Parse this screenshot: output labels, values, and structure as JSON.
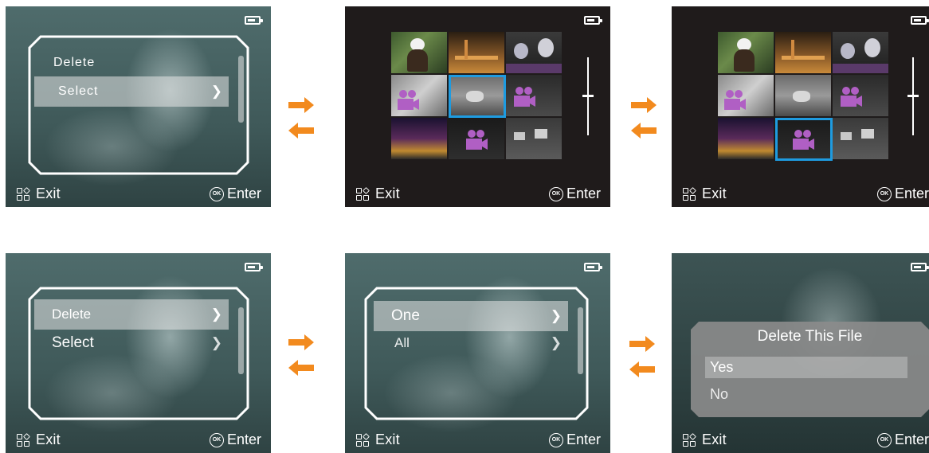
{
  "footer": {
    "exit_label": "Exit",
    "enter_label": "Enter",
    "ok_label": "OK"
  },
  "screen1": {
    "menu": [
      {
        "label": "Delete",
        "highlighted": false
      },
      {
        "label": "Select",
        "highlighted": true
      }
    ]
  },
  "screen4": {
    "menu": [
      {
        "label": "Delete",
        "highlighted": true
      },
      {
        "label": "Select",
        "highlighted": false
      }
    ]
  },
  "screen5": {
    "menu": [
      {
        "label": "One",
        "highlighted": true
      },
      {
        "label": "All",
        "highlighted": false
      }
    ]
  },
  "screen6": {
    "dialog_title": "Delete This File",
    "options": [
      {
        "label": "Yes",
        "highlighted": true
      },
      {
        "label": "No",
        "highlighted": false
      }
    ]
  },
  "thumbnails": {
    "screen2_selected_index": 4,
    "screen3_selected_index": 7,
    "items": [
      {
        "name": "eagle",
        "video": false
      },
      {
        "name": "wooden-deck",
        "video": false
      },
      {
        "name": "raccoons",
        "video": false
      },
      {
        "name": "tiger",
        "video": true
      },
      {
        "name": "deer-night",
        "video": false
      },
      {
        "name": "animal-night",
        "video": true
      },
      {
        "name": "city-night",
        "video": false
      },
      {
        "name": "dark-scene",
        "video": true
      },
      {
        "name": "deer-herd",
        "video": false
      }
    ]
  },
  "colors": {
    "accent_arrow": "#f28a1e",
    "selection": "#1e9be0",
    "video_icon": "#b05fc4"
  }
}
